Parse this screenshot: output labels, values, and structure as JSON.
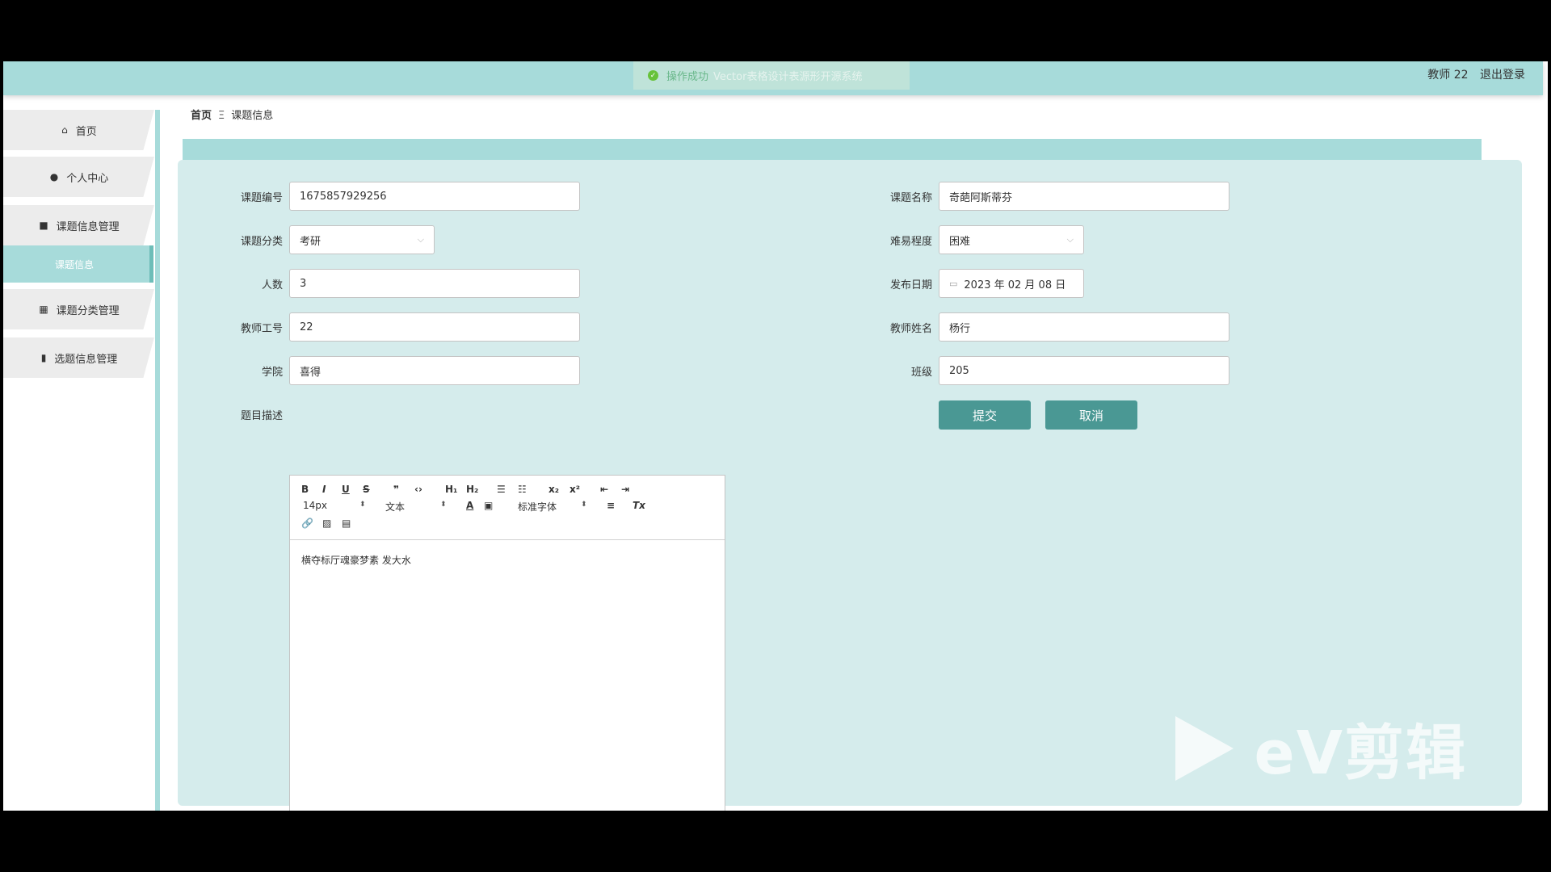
{
  "toast": {
    "title": "操作成功",
    "message": "Vector表格设计表源形开源系统"
  },
  "user": {
    "name": "教师 22",
    "logout": "退出登录"
  },
  "sidebar": {
    "items": [
      {
        "label": "首页",
        "icon": "home-icon",
        "glyph": "⌂"
      },
      {
        "label": "个人中心",
        "icon": "user-icon",
        "glyph": "●"
      },
      {
        "label": "课题信息管理",
        "icon": "briefcase-icon",
        "glyph": "■"
      },
      {
        "label": "课题分类管理",
        "icon": "grid-icon",
        "glyph": "▦"
      },
      {
        "label": "选题信息管理",
        "icon": "clipboard-icon",
        "glyph": "▮"
      }
    ],
    "sub_active": "课题信息"
  },
  "breadcrumb": {
    "home": "首页",
    "sep": "Ξ",
    "current": "课题信息"
  },
  "form": {
    "topic_no": {
      "label": "课题编号",
      "value": "1675857929256"
    },
    "topic_name": {
      "label": "课题名称",
      "value": "奇葩阿斯蒂芬"
    },
    "category": {
      "label": "课题分类",
      "value": "考研"
    },
    "difficulty": {
      "label": "难易程度",
      "value": "困难"
    },
    "count": {
      "label": "人数",
      "value": "3"
    },
    "publish_date": {
      "label": "发布日期",
      "value": "2023 年 02 月 08 日"
    },
    "teacher_no": {
      "label": "教师工号",
      "value": "22"
    },
    "teacher_name": {
      "label": "教师姓名",
      "value": "杨行"
    },
    "college": {
      "label": "学院",
      "value": "喜得"
    },
    "class": {
      "label": "班级",
      "value": "205"
    },
    "description": {
      "label": "题目描述",
      "value": "横夺标厅魂豪梦素 发大水"
    },
    "submit": "提交",
    "cancel": "取消"
  },
  "editor_toolbar": {
    "row1": [
      "B",
      "I",
      "U",
      "S",
      "❞",
      "‹›",
      "H₁",
      "H₂",
      "☰",
      "☷",
      "x₂",
      "x²",
      "⇤",
      "⇥"
    ],
    "font_size": "14px",
    "text_type": "文本",
    "font_family": "标准字体",
    "row2_icons": [
      "A",
      "▣",
      "≡",
      "Tx"
    ],
    "row3": [
      "🔗",
      "▨",
      "▤"
    ]
  },
  "watermark": "eV剪辑",
  "colors": {
    "accent": "#a7dbda",
    "button": "#4a9894",
    "panel": "#d5ecec"
  }
}
